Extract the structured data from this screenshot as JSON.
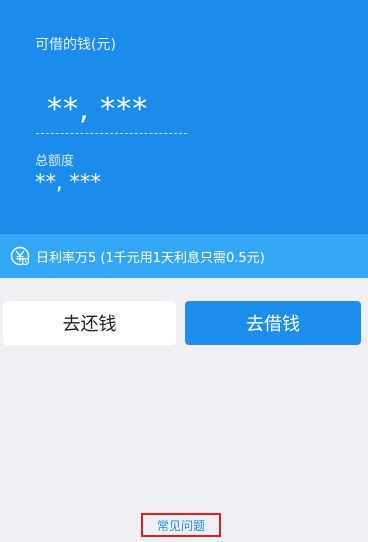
{
  "hero": {
    "available_label": "可借的钱(元)",
    "available_amount": "**, ***",
    "total_label": "总额度",
    "total_amount": "**, ***"
  },
  "rate_bar": {
    "icon": "yen-coin-icon",
    "text": "日利率万5 (1千元用1天利息只需0.5元)"
  },
  "actions": {
    "repay_label": "去还钱",
    "borrow_label": "去借钱"
  },
  "footer": {
    "faq_label": "常见问题"
  },
  "colors": {
    "hero_blue": "#1b8ceb",
    "rate_bar_blue": "#34a6f6",
    "borrow_button": "#1e8eec",
    "background": "#efeff4",
    "highlight_border": "#e02020"
  }
}
